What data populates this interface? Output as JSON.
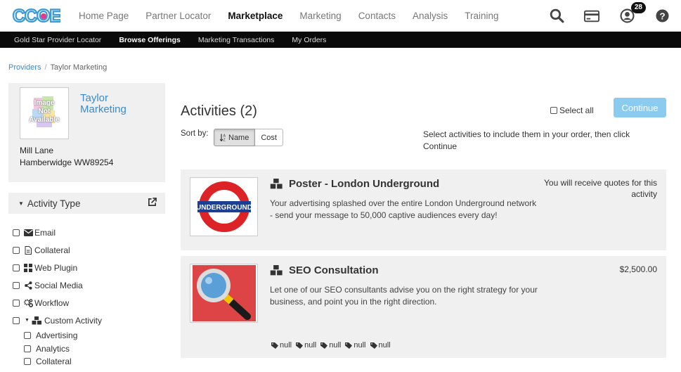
{
  "logo": {
    "text": "CCOE"
  },
  "main_nav": [
    {
      "label": "Home Page"
    },
    {
      "label": "Partner Locator"
    },
    {
      "label": "Marketplace"
    },
    {
      "label": "Marketing"
    },
    {
      "label": "Contacts"
    },
    {
      "label": "Analysis"
    },
    {
      "label": "Training"
    }
  ],
  "notifications_count": "28",
  "sub_nav": [
    {
      "label": "Gold Star Provider Locator"
    },
    {
      "label": "Browse Offerings"
    },
    {
      "label": "Marketing Transactions"
    },
    {
      "label": "My Orders"
    }
  ],
  "breadcrumb": {
    "root": "Providers",
    "separator": "/",
    "current": "Taylor Marketing"
  },
  "provider": {
    "name": "Taylor Marketing",
    "image_placeholder": "Image Not Available",
    "address_line1": "Mill Lane",
    "address_line2": "Hamberwidge WW89254"
  },
  "filter": {
    "heading": "Activity Type",
    "items": [
      {
        "label": "Email",
        "icon": "envelope-icon"
      },
      {
        "label": "Collateral",
        "icon": "document-icon"
      },
      {
        "label": "Web Plugin",
        "icon": "grid-icon"
      },
      {
        "label": "Social Media",
        "icon": "share-icon"
      },
      {
        "label": "Workflow",
        "icon": "cogs-icon"
      },
      {
        "label": "Custom Activity",
        "icon": "cubes-icon"
      }
    ],
    "sub_items": [
      {
        "label": "Advertising"
      },
      {
        "label": "Analytics"
      },
      {
        "label": "Collateral"
      }
    ]
  },
  "activities": {
    "title": "Activities (2)",
    "select_all_label": "Select all",
    "continue_label": "Continue",
    "sort_label": "Sort by:",
    "sort_name": "Name",
    "sort_cost": "Cost",
    "instructions": "Select activities to include them in your order, then click Continue"
  },
  "cards": [
    {
      "title": "Poster - London Underground",
      "description": "Your advertising splashed over the entire London Underground network - send your message to 50,000 captive audiences every day!",
      "price": "You will receive quotes for this activity",
      "thumb_text": "UNDERGROUND"
    },
    {
      "title": "SEO Consultation",
      "description": "Let one of our SEO consultants advise you on the right strategy for your business, and point you in the right direction.",
      "price": "$2,500.00",
      "tags": [
        "null",
        "null",
        "null",
        "null",
        "null"
      ]
    }
  ],
  "colors": {
    "link": "#3a8bcd",
    "subnav_bg": "#0a0a0a",
    "continue_bg": "#8ccbf0",
    "panel_bg": "#f0f0f0"
  }
}
